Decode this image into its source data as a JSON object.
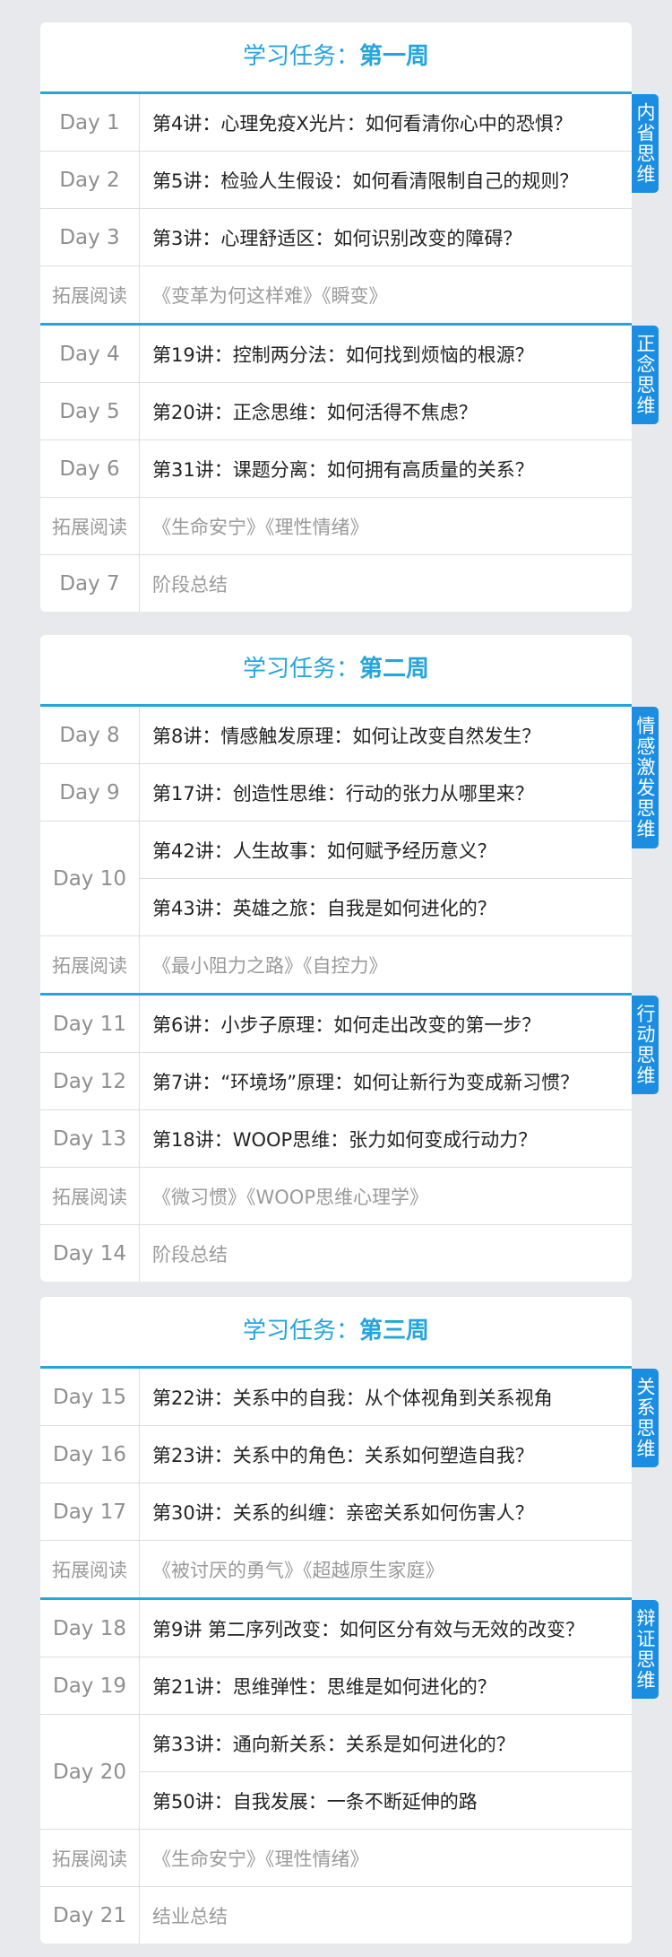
{
  "weeks": [
    {
      "title_prefix": "学习任务：",
      "title_em": "第一周",
      "groups": [
        {
          "tag": "内省思维",
          "rows": [
            {
              "day": "Day 1",
              "lectures": [
                "第4讲：心理免疫X光片：如何看清你心中的恐惧？"
              ]
            },
            {
              "day": "Day 2",
              "lectures": [
                "第5讲：检验人生假设：如何看清限制自己的规则？"
              ]
            },
            {
              "day": "Day 3",
              "lectures": [
                "第3讲：心理舒适区：如何识别改变的障碍？"
              ]
            },
            {
              "day": "拓展阅读",
              "lectures": [
                "《变革为何这样难》《瞬变》"
              ]
            }
          ]
        },
        {
          "tag": "正念思维",
          "rows": [
            {
              "day": "Day 4",
              "lectures": [
                "第19讲：控制两分法：如何找到烦恼的根源？"
              ]
            },
            {
              "day": "Day 5",
              "lectures": [
                "第20讲：正念思维：如何活得不焦虑？"
              ]
            },
            {
              "day": "Day 6",
              "lectures": [
                "第31讲：课题分离：如何拥有高质量的关系？"
              ]
            },
            {
              "day": "拓展阅读",
              "lectures": [
                "《生命安宁》《理性情绪》"
              ]
            },
            {
              "day": "Day 7",
              "lectures": [
                "阶段总结"
              ]
            }
          ]
        }
      ]
    },
    {
      "title_prefix": "学习任务：",
      "title_em": "第二周",
      "groups": [
        {
          "tag": "情感激发思维",
          "rows": [
            {
              "day": "Day 8",
              "lectures": [
                "第8讲：情感触发原理：如何让改变自然发生？"
              ]
            },
            {
              "day": "Day 9",
              "lectures": [
                "第17讲：创造性思维：行动的张力从哪里来？"
              ]
            },
            {
              "day": "Day 10",
              "lectures": [
                "第42讲：人生故事：如何赋予经历意义？",
                "第43讲：英雄之旅：自我是如何进化的？"
              ]
            },
            {
              "day": "拓展阅读",
              "lectures": [
                "《最小阻力之路》《自控力》"
              ]
            }
          ]
        },
        {
          "tag": "行动思维",
          "rows": [
            {
              "day": "Day 11",
              "lectures": [
                "第6讲：小步子原理：如何走出改变的第一步？"
              ]
            },
            {
              "day": "Day 12",
              "lectures": [
                "第7讲：“环境场”原理：如何让新行为变成新习惯？"
              ]
            },
            {
              "day": "Day 13",
              "lectures": [
                "第18讲：WOOP思维：张力如何变成行动力？"
              ]
            },
            {
              "day": "拓展阅读",
              "lectures": [
                "《微习惯》《WOOP思维心理学》"
              ]
            },
            {
              "day": "Day 14",
              "lectures": [
                "阶段总结"
              ]
            }
          ]
        }
      ]
    },
    {
      "title_prefix": "学习任务：",
      "title_em": "第三周",
      "groups": [
        {
          "tag": "关系思维",
          "rows": [
            {
              "day": "Day 15",
              "lectures": [
                "第22讲：关系中的自我：从个体视角到关系视角"
              ]
            },
            {
              "day": "Day 16",
              "lectures": [
                "第23讲：关系中的角色：关系如何塑造自我？"
              ]
            },
            {
              "day": "Day 17",
              "lectures": [
                "第30讲：关系的纠缠：亲密关系如何伤害人？"
              ]
            },
            {
              "day": "拓展阅读",
              "lectures": [
                "《被讨厌的勇气》《超越原生家庭》"
              ]
            }
          ]
        },
        {
          "tag": "辩证思维",
          "rows": [
            {
              "day": "Day 18",
              "lectures": [
                "第9讲 第二序列改变：如何区分有效与无效的改变？"
              ]
            },
            {
              "day": "Day 19",
              "lectures": [
                "第21讲：思维弹性：思维是如何进化的？"
              ]
            },
            {
              "day": "Day 20",
              "lectures": [
                "第33讲：通向新关系：关系是如何进化的？",
                "第50讲：自我发展：一条不断延伸的路"
              ]
            },
            {
              "day": "拓展阅读",
              "lectures": [
                "《生命安宁》《理性情绪》"
              ]
            },
            {
              "day": "Day 21",
              "lectures": [
                "结业总结"
              ]
            }
          ]
        }
      ]
    }
  ]
}
